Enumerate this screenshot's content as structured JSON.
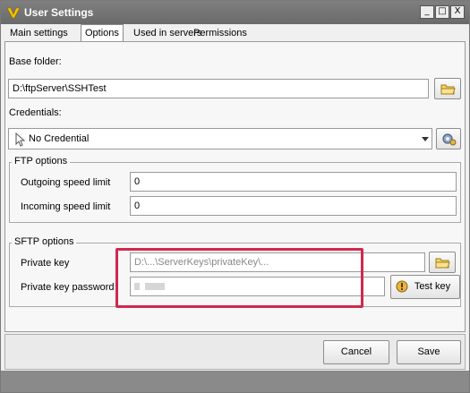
{
  "window": {
    "title": "User Settings",
    "icon": "app-logo-icon"
  },
  "titlebar_buttons": {
    "minimize": "_",
    "maximize": "□",
    "close": "X"
  },
  "tabs": [
    {
      "label": "Main settings",
      "active": false
    },
    {
      "label": "Options",
      "active": true
    },
    {
      "label": "Used in servers",
      "active": false
    },
    {
      "label": "Permissions",
      "active": false
    }
  ],
  "base_folder": {
    "label": "Base folder:",
    "value": "D:\\ftpServer\\SSHTest",
    "browse_icon": "folder-icon"
  },
  "credentials": {
    "label": "Credentials:",
    "selected": "No Credential",
    "icon": "cursor-icon",
    "settings_icon": "gear-icon"
  },
  "ftp_options": {
    "title": "FTP options",
    "outgoing_label": "Outgoing speed limit",
    "outgoing_value": "0",
    "incoming_label": "Incoming speed limit",
    "incoming_value": "0"
  },
  "sftp_options": {
    "title": "SFTP options",
    "private_key_label": "Private key",
    "private_key_value": "D:\\...\\ServerKeys\\privateKey\\...",
    "private_key_password_label": "Private key password",
    "test_key_label": "Test key",
    "test_key_icon": "key-icon"
  },
  "footer": {
    "cancel_label": "Cancel",
    "save_label": "Save"
  },
  "highlight_color": "#d0294e"
}
